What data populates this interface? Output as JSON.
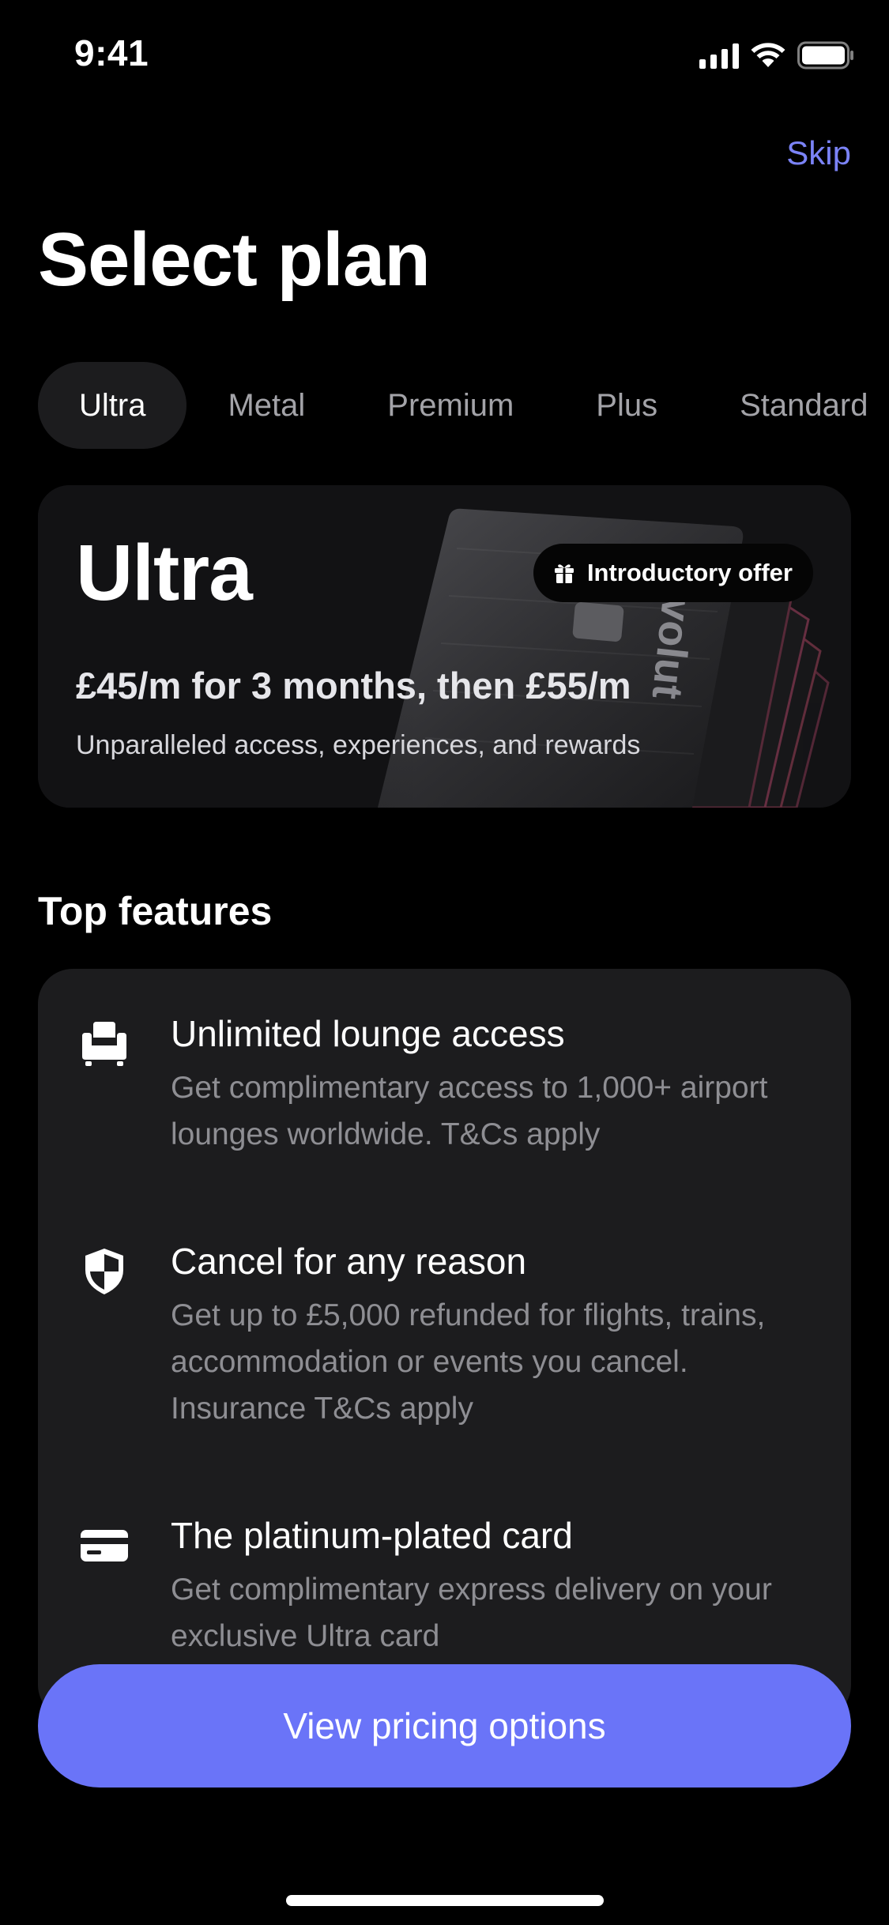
{
  "status_bar": {
    "time": "9:41"
  },
  "header": {
    "skip_label": "Skip",
    "title": "Select plan"
  },
  "tabs": [
    {
      "label": "Ultra",
      "active": true
    },
    {
      "label": "Metal",
      "active": false
    },
    {
      "label": "Premium",
      "active": false
    },
    {
      "label": "Plus",
      "active": false
    },
    {
      "label": "Standard",
      "active": false
    }
  ],
  "plan_card": {
    "name": "Ultra",
    "badge_label": "Introductory offer",
    "badge_icon": "gift-icon",
    "price": "£45/m for 3 months, then £55/m",
    "tagline": "Unparalleled access, experiences, and rewards"
  },
  "features": {
    "section_title": "Top features",
    "items": [
      {
        "icon": "lounge-chair-icon",
        "title": "Unlimited lounge access",
        "description": "Get complimentary access to 1,000+ airport lounges worldwide. T&Cs apply"
      },
      {
        "icon": "shield-icon",
        "title": "Cancel for any reason",
        "description": "Get up to £5,000 refunded for flights, trains, accommodation or events you cancel. Insurance T&Cs apply"
      },
      {
        "icon": "card-icon",
        "title": "The platinum-plated card",
        "description": "Get complimentary express delivery on your exclusive Ultra card"
      }
    ]
  },
  "cta": {
    "label": "View pricing options"
  },
  "colors": {
    "accent": "#6a74f8",
    "link": "#7b83f7",
    "background": "#000000",
    "card": "#1c1c1e",
    "muted_text": "#8e8e93"
  }
}
